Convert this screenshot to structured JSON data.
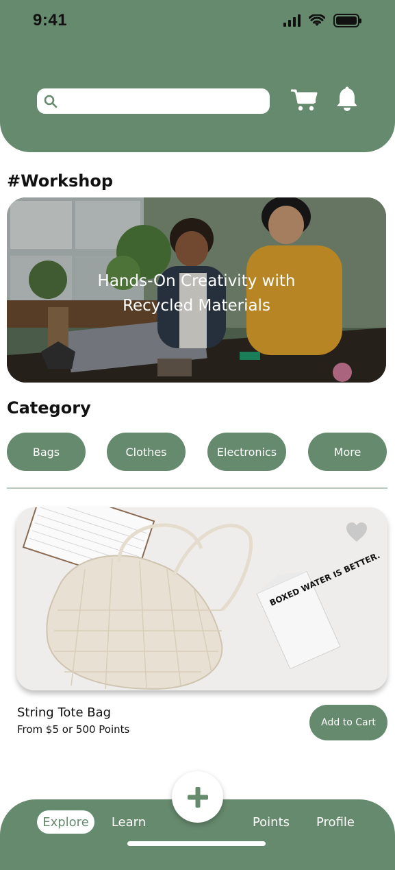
{
  "status_bar": {
    "time": "9:41"
  },
  "search": {
    "placeholder": ""
  },
  "workshop": {
    "title": "#Workshop",
    "caption_line1": "Hands-On Creativity with",
    "caption_line2": "Recycled Materials"
  },
  "category": {
    "title": "Category",
    "items": [
      {
        "label": "Bags"
      },
      {
        "label": "Clothes"
      },
      {
        "label": "Electronics"
      },
      {
        "label": "More"
      }
    ]
  },
  "product": {
    "name": "String Tote Bag",
    "price": "From $5 or 500 Points",
    "add_to_cart": "Add to Cart",
    "carton_text": "BOXED WATER IS BETTER."
  },
  "nav": {
    "items": [
      {
        "label": "Explore",
        "active": true
      },
      {
        "label": "Learn",
        "active": false
      },
      {
        "label": "Points",
        "active": false
      },
      {
        "label": "Profile",
        "active": false
      }
    ]
  },
  "colors": {
    "primary": "#668a6d",
    "divider": "#b8c9bd",
    "background": "#ffffff"
  },
  "icons": [
    "search-icon",
    "cart-icon",
    "bell-icon",
    "heart-icon",
    "plus-icon",
    "signal-icon",
    "wifi-icon",
    "battery-icon"
  ]
}
